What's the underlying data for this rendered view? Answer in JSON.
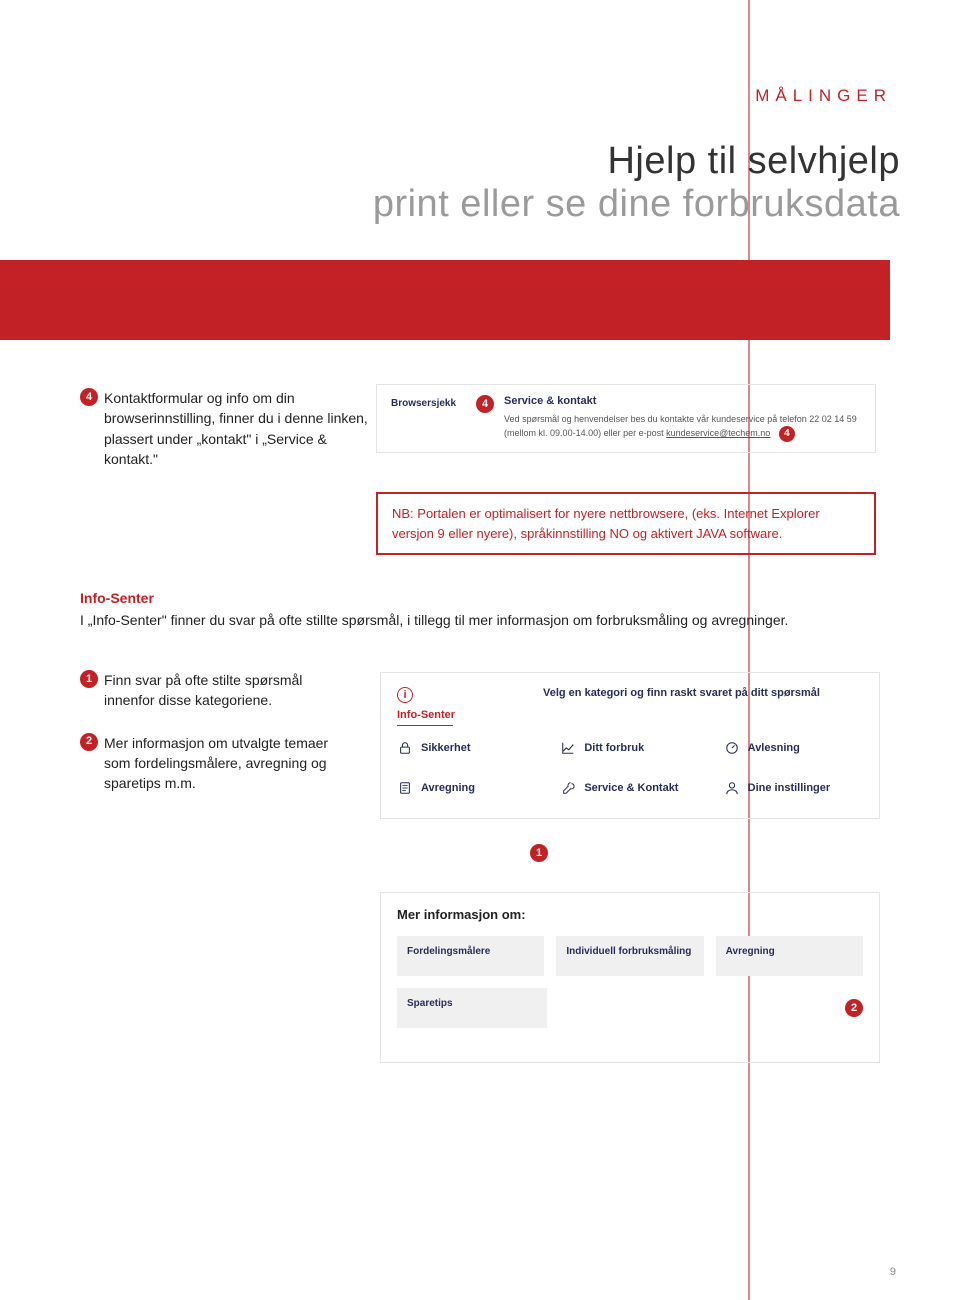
{
  "running_head": "MÅLINGER",
  "title": {
    "line1": "Hjelp til selvhjelp",
    "line2": "print eller se dine forbruksdata"
  },
  "sec4": {
    "bullet": "4",
    "text": "Kontaktformular og info om din browserinnstilling, finner du i denne linken, plassert under „kontakt\" i „Service & kontakt.\""
  },
  "snippet": {
    "browsersjekk": "Browsersjekk",
    "bullet": "4",
    "svc_title": "Service & kontakt",
    "svc_body_pre": "Ved spørsmål og henvendelser bes du kontakte vår kundeservice på telefon 22 02 14 59 (mellom kl. 09.00-14.00) eller per e-post ",
    "svc_email": "kundeservice@techem.no",
    "sub_bullet": "4"
  },
  "nb_box": "NB: Portalen er optimalisert for nyere nettbrowsere, (eks. Internet Explorer versjon 9 eller nyere), språkinnstilling NO og aktivert JAVA software.",
  "info_senter": {
    "heading": "Info-Senter",
    "body": "I „Info-Senter\" finner du svar på ofte stillte spørsmål, i tillegg til mer informasjon om forbruksmåling og avregninger."
  },
  "faq_items": [
    {
      "n": "1",
      "text": "Finn svar på ofte stilte spørsmål innenfor disse kategoriene."
    },
    {
      "n": "2",
      "text": "Mer informasjon om utvalgte temaer som fordelingsmålere, avregning og sparetips m.m."
    }
  ],
  "cat_panel": {
    "label": "Info-Senter",
    "prompt": "Velg en kategori og finn raskt svaret på ditt spørsmål",
    "items": [
      "Sikkerhet",
      "Ditt forbruk",
      "Avlesning",
      "Avregning",
      "Service & Kontakt",
      "Dine instillinger"
    ],
    "badge": "1"
  },
  "more_panel": {
    "title": "Mer informasjon om:",
    "row1": [
      "Fordelingsmålere",
      "Individuell forbruksmåling",
      "Avregning"
    ],
    "row2": [
      "Sparetips"
    ],
    "badge": "2"
  },
  "page_number": "9"
}
